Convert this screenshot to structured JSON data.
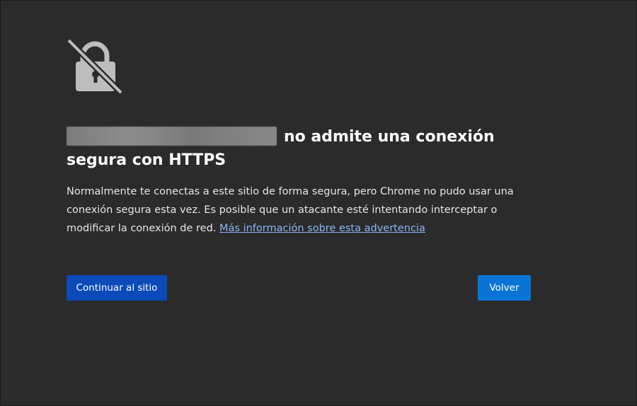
{
  "page": {
    "headline_site": "",
    "headline_text": "no admite una conexión segura con HTTPS",
    "description": "Normalmente te conectas a este sitio de forma segura, pero Chrome no pudo usar una conexión segura esta vez. Es posible que un atacante esté intentando interceptar o modificar la conexión de red.",
    "learn_more_link": "Más información sobre esta advertencia",
    "continue_button": "Continuar al sitio",
    "back_button": "Volver"
  },
  "icons": {
    "status": "lock-crossed-icon"
  },
  "colors": {
    "background": "#2b2b2b",
    "link": "#8ab4f8",
    "continue_button": "#0b4ab8",
    "back_button": "#0a74d6",
    "icon": "#bdbdbd"
  }
}
